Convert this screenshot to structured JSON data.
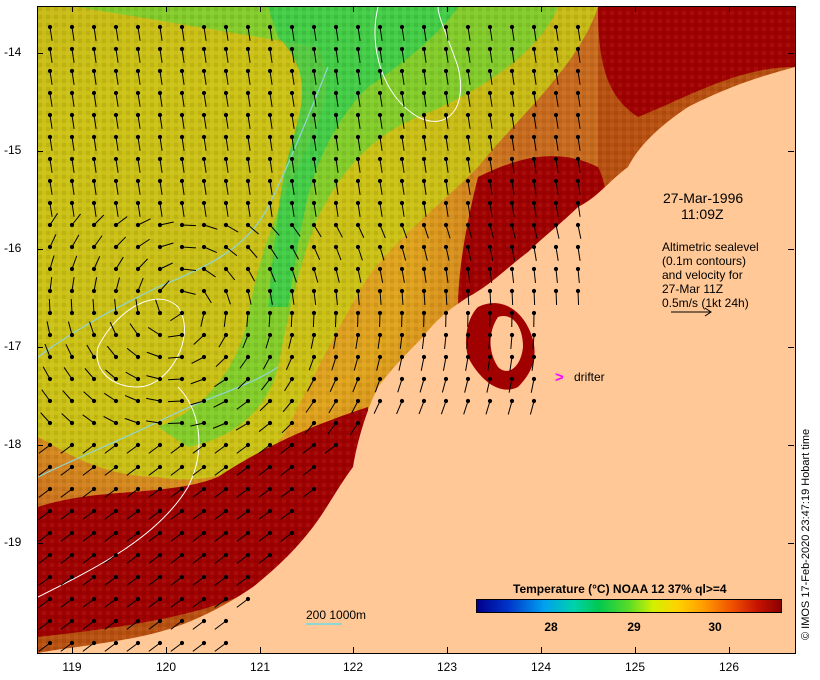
{
  "map": {
    "latitudes": [
      "-14",
      "-15",
      "-16",
      "-17",
      "-18",
      "-19"
    ],
    "longitudes": [
      "119",
      "120",
      "121",
      "122",
      "123",
      "124",
      "125",
      "126"
    ],
    "lat_range": [
      -14,
      -20
    ],
    "lon_range": [
      118.6,
      126.7
    ],
    "date_line": "27-Mar-1996",
    "time_line": "11:09Z",
    "info_lines": [
      "Altimetric sealevel",
      "(0.1m contours)",
      "and velocity for",
      "27-Mar 11Z",
      "0.5m/s (1kt 24h)"
    ],
    "drifter_label": "drifter",
    "drifter_marker": ">",
    "contour_key": "200  1000m",
    "colorbar_title": "Temperature (°C) NOAA 12 37% ql>=4",
    "colorbar_labels": [
      "28",
      "29",
      "30"
    ],
    "copyright": "© IMOS 17-Feb-2020 23:47:19 Hobart time",
    "colors": {
      "land": "#ffc896",
      "warm": "#a00000",
      "mid": "#d2a000",
      "cool": "#3cc850",
      "arrow": "#000000",
      "contour": "#8fd6d6",
      "drifter": "#ff00ff"
    }
  }
}
